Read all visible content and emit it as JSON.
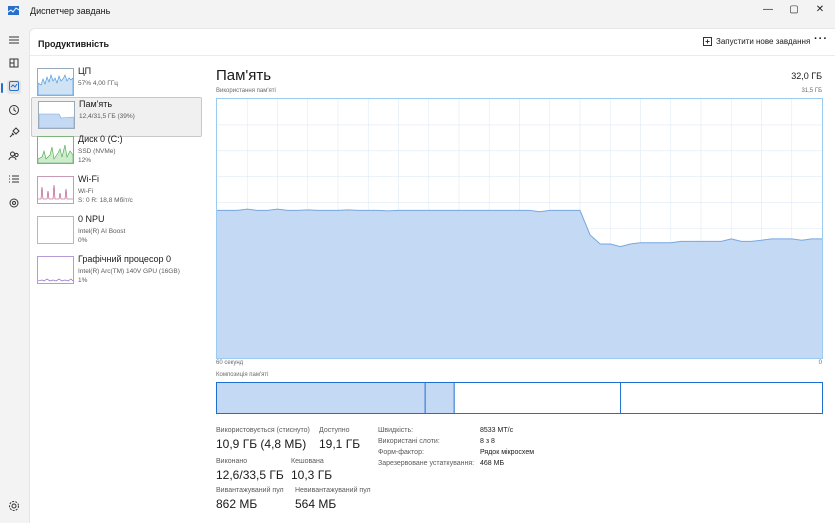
{
  "window": {
    "title": "Диспетчер завдань",
    "min": "—",
    "max": "▢",
    "close": "✕"
  },
  "header": {
    "title": "Продуктивність",
    "new_task": "Запустити нове завдання",
    "more": "···"
  },
  "sidebar_icons": [
    "hamburger-icon",
    "processes-icon",
    "performance-icon",
    "history-icon",
    "startup-icon",
    "users-icon",
    "details-icon",
    "services-icon",
    "settings-icon"
  ],
  "items": [
    {
      "name": "ЦП",
      "sub1": "57% 4,00 ГГц",
      "sub2": "",
      "sub3": ""
    },
    {
      "name": "Пам'ять",
      "sub1": "12,4/31,5 ГБ (39%)",
      "sub2": "",
      "sub3": ""
    },
    {
      "name": "Диск 0 (C:)",
      "sub1": "SSD (NVMe)",
      "sub2": "12%",
      "sub3": ""
    },
    {
      "name": "Wi-Fi",
      "sub1": "Wi-Fi",
      "sub2": "S: 0  R: 18,8 Мбіт/с",
      "sub3": ""
    },
    {
      "name": "0 NPU",
      "sub1": "Intel(R) AI Boost",
      "sub2": "0%",
      "sub3": ""
    },
    {
      "name": "Графічний процесор 0",
      "sub1": "Intel(R) Arc(TM) 140V GPU (16GB)",
      "sub2": "1%",
      "sub3": ""
    }
  ],
  "main": {
    "title": "Пам'ять",
    "total": "32,0 ГБ",
    "usage_label": "Використання пам'яті",
    "usage_max": "31,5 ГБ",
    "time_left": "60 секунд",
    "time_right": "0",
    "composition_label": "Композиція пам'яті"
  },
  "usage_series": [
    0.57,
    0.57,
    0.57,
    0.575,
    0.57,
    0.57,
    0.575,
    0.57,
    0.57,
    0.572,
    0.57,
    0.57,
    0.57,
    0.572,
    0.57,
    0.57,
    0.57,
    0.568,
    0.57,
    0.57,
    0.57,
    0.57,
    0.57,
    0.57,
    0.57,
    0.57,
    0.57,
    0.57,
    0.57,
    0.57,
    0.57,
    0.57,
    0.565,
    0.57,
    0.57,
    0.57,
    0.57,
    0.475,
    0.44,
    0.44,
    0.43,
    0.44,
    0.445,
    0.445,
    0.445,
    0.445,
    0.45,
    0.45,
    0.45,
    0.45,
    0.45,
    0.46,
    0.45,
    0.45,
    0.455,
    0.46,
    0.46,
    0.46,
    0.455,
    0.46,
    0.46
  ],
  "composition": {
    "in_use": 0.344,
    "modified": 0.048,
    "standby": 0.275,
    "free": 0.333
  },
  "stats": {
    "in_use_label": "Використовується (стиснуто)",
    "in_use": "10,9 ГБ (4,8 МБ)",
    "available_label": "Доступно",
    "available": "19,1 ГБ",
    "committed_label": "Виконано",
    "committed": "12,6/33,5 ГБ",
    "cached_label": "Кешована",
    "cached": "10,3 ГБ",
    "paged_label": "Вивантажуваний пул",
    "paged": "862 МБ",
    "nonpaged_label": "Невивантажуваний пул",
    "nonpaged": "564 МБ"
  },
  "specs": [
    {
      "k": "Швидкість:",
      "v": "8533 MT/c"
    },
    {
      "k": "Використані слоти:",
      "v": "8 з 8"
    },
    {
      "k": "Форм-фактор:",
      "v": "Рядок мікросхем"
    },
    {
      "k": "Зарезервоване устаткування:",
      "v": "468 МБ"
    }
  ],
  "colors": {
    "accent": "#2670cc",
    "mem_fill": "#c4d9f4",
    "mem_line": "#76a8e0",
    "grid": "#dfeaf7"
  }
}
